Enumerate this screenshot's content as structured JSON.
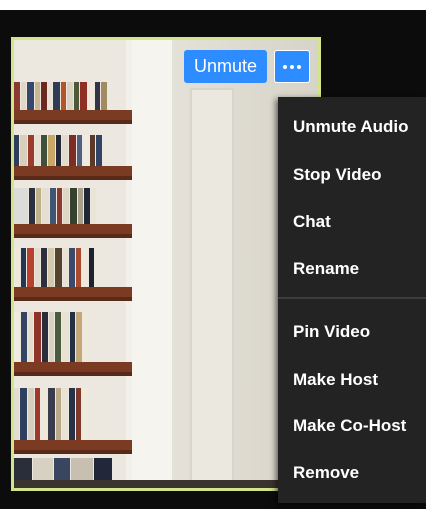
{
  "controls": {
    "unmute_label": "Unmute",
    "more_icon": "more-horizontal-icon"
  },
  "menu": {
    "items": [
      {
        "label": "Unmute Audio"
      },
      {
        "label": "Stop Video"
      },
      {
        "label": "Chat"
      },
      {
        "label": "Rename"
      },
      {
        "label": "Pin Video"
      },
      {
        "label": "Make Host"
      },
      {
        "label": "Make Co-Host"
      },
      {
        "label": "Remove"
      }
    ]
  },
  "colors": {
    "accent": "#2d8cff",
    "active_speaker_border": "#d2e58a",
    "menu_bg": "#232323"
  }
}
